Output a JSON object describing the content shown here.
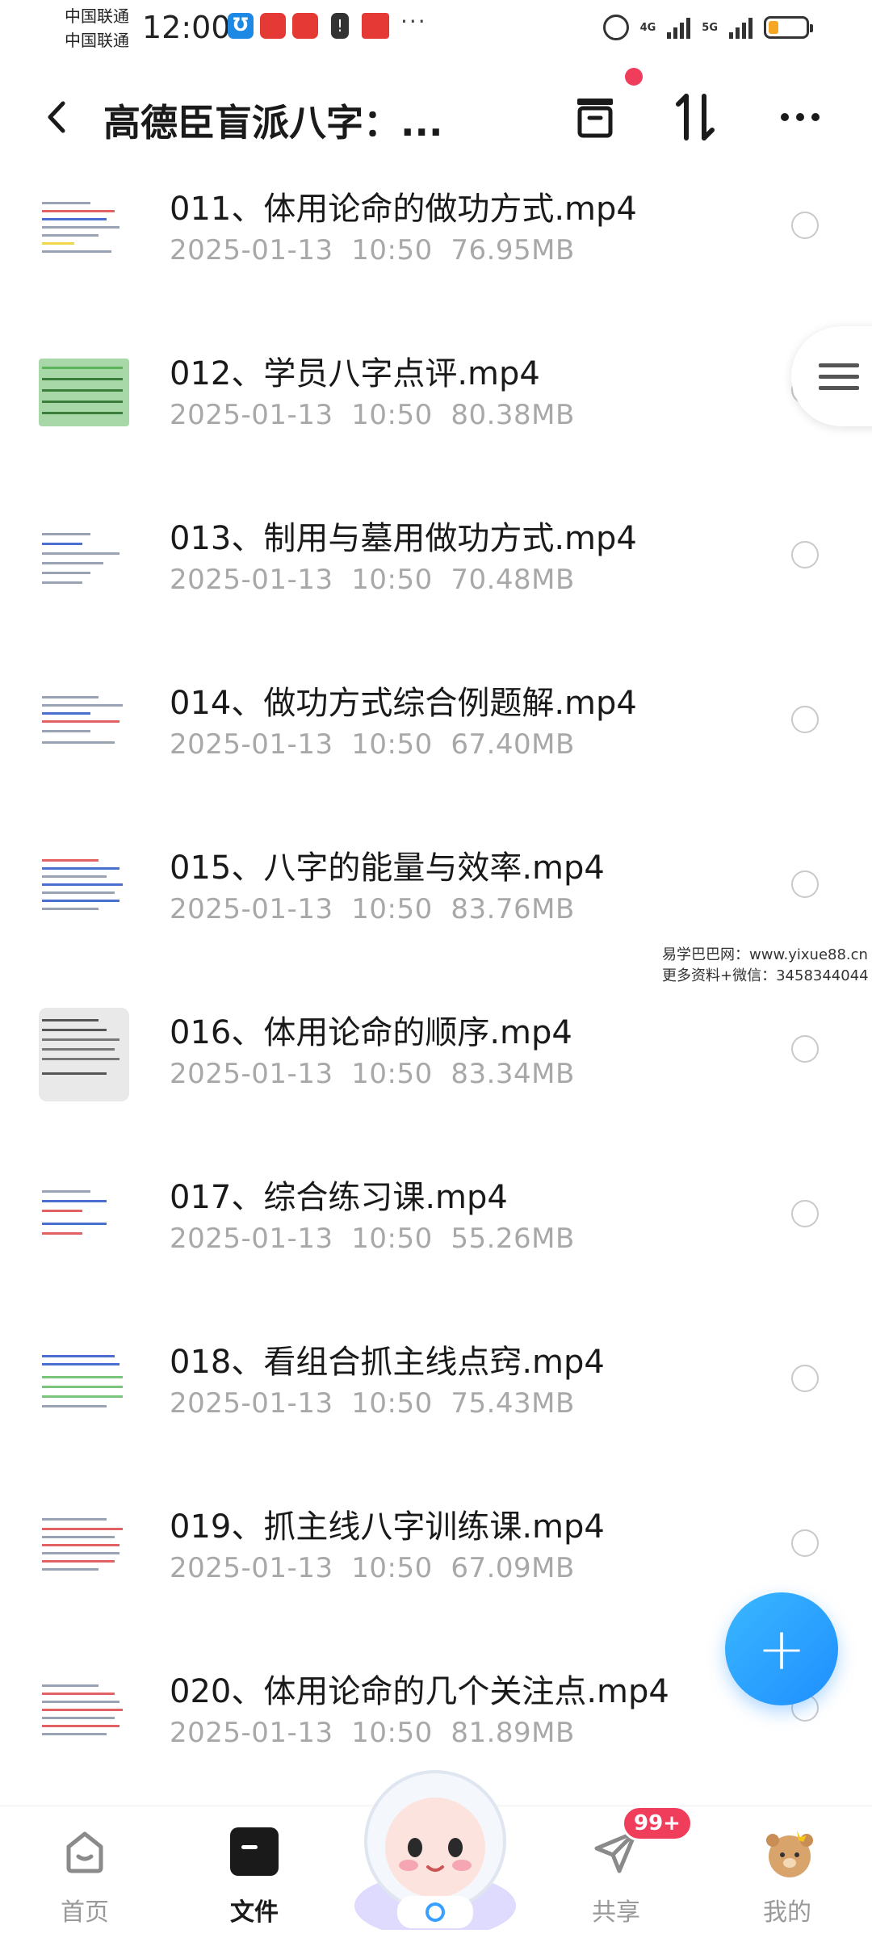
{
  "status_bar": {
    "carrier_1": "中国联通",
    "carrier_2": "中国联通",
    "time": "12:00",
    "net_1": "4G",
    "net_2": "5G"
  },
  "header": {
    "title": "高德臣盲派八字：...",
    "back_icon": "chevron-left-icon",
    "sort_icon": "sort-arrows-icon",
    "bin_icon": "archive-box-icon",
    "more_icon": "more-horizontal-icon"
  },
  "files": [
    {
      "name": "011、体用论命的做功方式.mp4",
      "date": "2025-01-13",
      "time": "10:50",
      "size": "76.95MB"
    },
    {
      "name": "012、学员八字点评.mp4",
      "date": "2025-01-13",
      "time": "10:50",
      "size": "80.38MB"
    },
    {
      "name": "013、制用与墓用做功方式.mp4",
      "date": "2025-01-13",
      "time": "10:50",
      "size": "70.48MB"
    },
    {
      "name": "014、做功方式综合例题解.mp4",
      "date": "2025-01-13",
      "time": "10:50",
      "size": "67.40MB"
    },
    {
      "name": "015、八字的能量与效率.mp4",
      "date": "2025-01-13",
      "time": "10:50",
      "size": "83.76MB"
    },
    {
      "name": "016、体用论命的顺序.mp4",
      "date": "2025-01-13",
      "time": "10:50",
      "size": "83.34MB"
    },
    {
      "name": "017、综合练习课.mp4",
      "date": "2025-01-13",
      "time": "10:50",
      "size": "55.26MB"
    },
    {
      "name": "018、看组合抓主线点窍.mp4",
      "date": "2025-01-13",
      "time": "10:50",
      "size": "75.43MB"
    },
    {
      "name": "019、抓主线八字训练课.mp4",
      "date": "2025-01-13",
      "time": "10:50",
      "size": "67.09MB"
    },
    {
      "name": "020、体用论命的几个关注点.mp4",
      "date": "2025-01-13",
      "time": "10:50",
      "size": "81.89MB"
    }
  ],
  "watermark": {
    "line_1": "易学巴巴网：www.yixue88.cn",
    "line_2": "更多资料+微信：3458344044"
  },
  "fab": {
    "label": "+"
  },
  "bottom_nav": {
    "home": "首页",
    "files": "文件",
    "share": "共享",
    "mine": "我的",
    "share_badge": "99+"
  },
  "colors": {
    "accent_red": "#f03d5c",
    "fab_blue": "#1f8fff",
    "meta_gray": "#a8a8a8"
  }
}
